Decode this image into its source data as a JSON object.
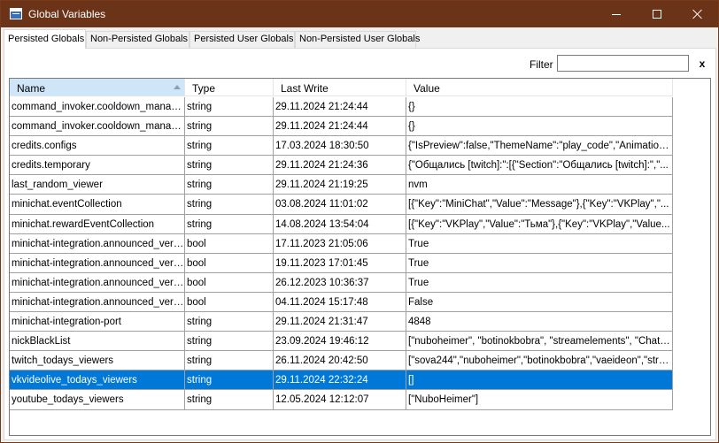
{
  "window": {
    "title": "Global Variables"
  },
  "tabs": [
    {
      "label": "Persisted Globals",
      "active": true
    },
    {
      "label": "Non-Persisted Globals",
      "active": false
    },
    {
      "label": "Persisted User Globals",
      "active": false
    },
    {
      "label": "Non-Persisted User Globals",
      "active": false
    }
  ],
  "filter": {
    "label": "Filter",
    "value": "",
    "clear_label": "x"
  },
  "grid": {
    "columns": [
      "Name",
      "Type",
      "Last Write",
      "Value"
    ],
    "sorted_column": "Name",
    "selected_row": 14,
    "rows": [
      [
        "command_invoker.cooldown_manager...",
        "string",
        "29.11.2024 21:24:44",
        "{}"
      ],
      [
        "command_invoker.cooldown_manager...",
        "string",
        "29.11.2024 21:24:44",
        "{}"
      ],
      [
        "credits.configs",
        "string",
        "17.03.2024 18:30:50",
        "{\"IsPreview\":false,\"ThemeName\":\"play_code\",\"AnimationS..."
      ],
      [
        "credits.temporary",
        "string",
        "29.11.2024 21:24:36",
        "{\"Общались [twitch]:\":[{\"Section\":\"Общались [twitch]:\",\"..."
      ],
      [
        "last_random_viewer",
        "string",
        "29.11.2024 21:19:25",
        "nvm"
      ],
      [
        "minichat.eventCollection",
        "string",
        "03.08.2024 11:01:02",
        "[{\"Key\":\"MiniChat\",\"Value\":\"Message\"},{\"Key\":\"VKPlay\",\"..."
      ],
      [
        "minichat.rewardEventCollection",
        "string",
        "14.08.2024 13:54:04",
        "[{\"Key\":\"VKPlay\",\"Value\":\"Тьма\"},{\"Key\":\"VKPlay\",\"Value..."
      ],
      [
        "minichat-integration.announced_versio...",
        "bool",
        "17.11.2023 21:05:06",
        "True"
      ],
      [
        "minichat-integration.announced_versio...",
        "bool",
        "19.11.2023 17:01:45",
        "True"
      ],
      [
        "minichat-integration.announced_versio...",
        "bool",
        "26.12.2023 10:36:37",
        "True"
      ],
      [
        "minichat-integration.announced_versio...",
        "bool",
        "04.11.2024 15:17:48",
        "False"
      ],
      [
        "minichat-integration-port",
        "string",
        "29.11.2024 21:31:47",
        "4848"
      ],
      [
        "nickBlackList",
        "string",
        "23.09.2024 19:46:12",
        "[\"nuboheimer\", \"botinokbobra\", \"streamelements\", \"ChatBo..."
      ],
      [
        "twitch_todays_viewers",
        "string",
        "26.11.2024 20:42:50",
        "[\"sova244\",\"nuboheimer\",\"botinokbobra\",\"vaeideon\",\"stre..."
      ],
      [
        "vkvideolive_todays_viewers",
        "string",
        "29.11.2024 22:32:24",
        "[]"
      ],
      [
        "youtube_todays_viewers",
        "string",
        "12.05.2024 12:12:07",
        "[\"NuboHeimer\"]"
      ]
    ]
  }
}
